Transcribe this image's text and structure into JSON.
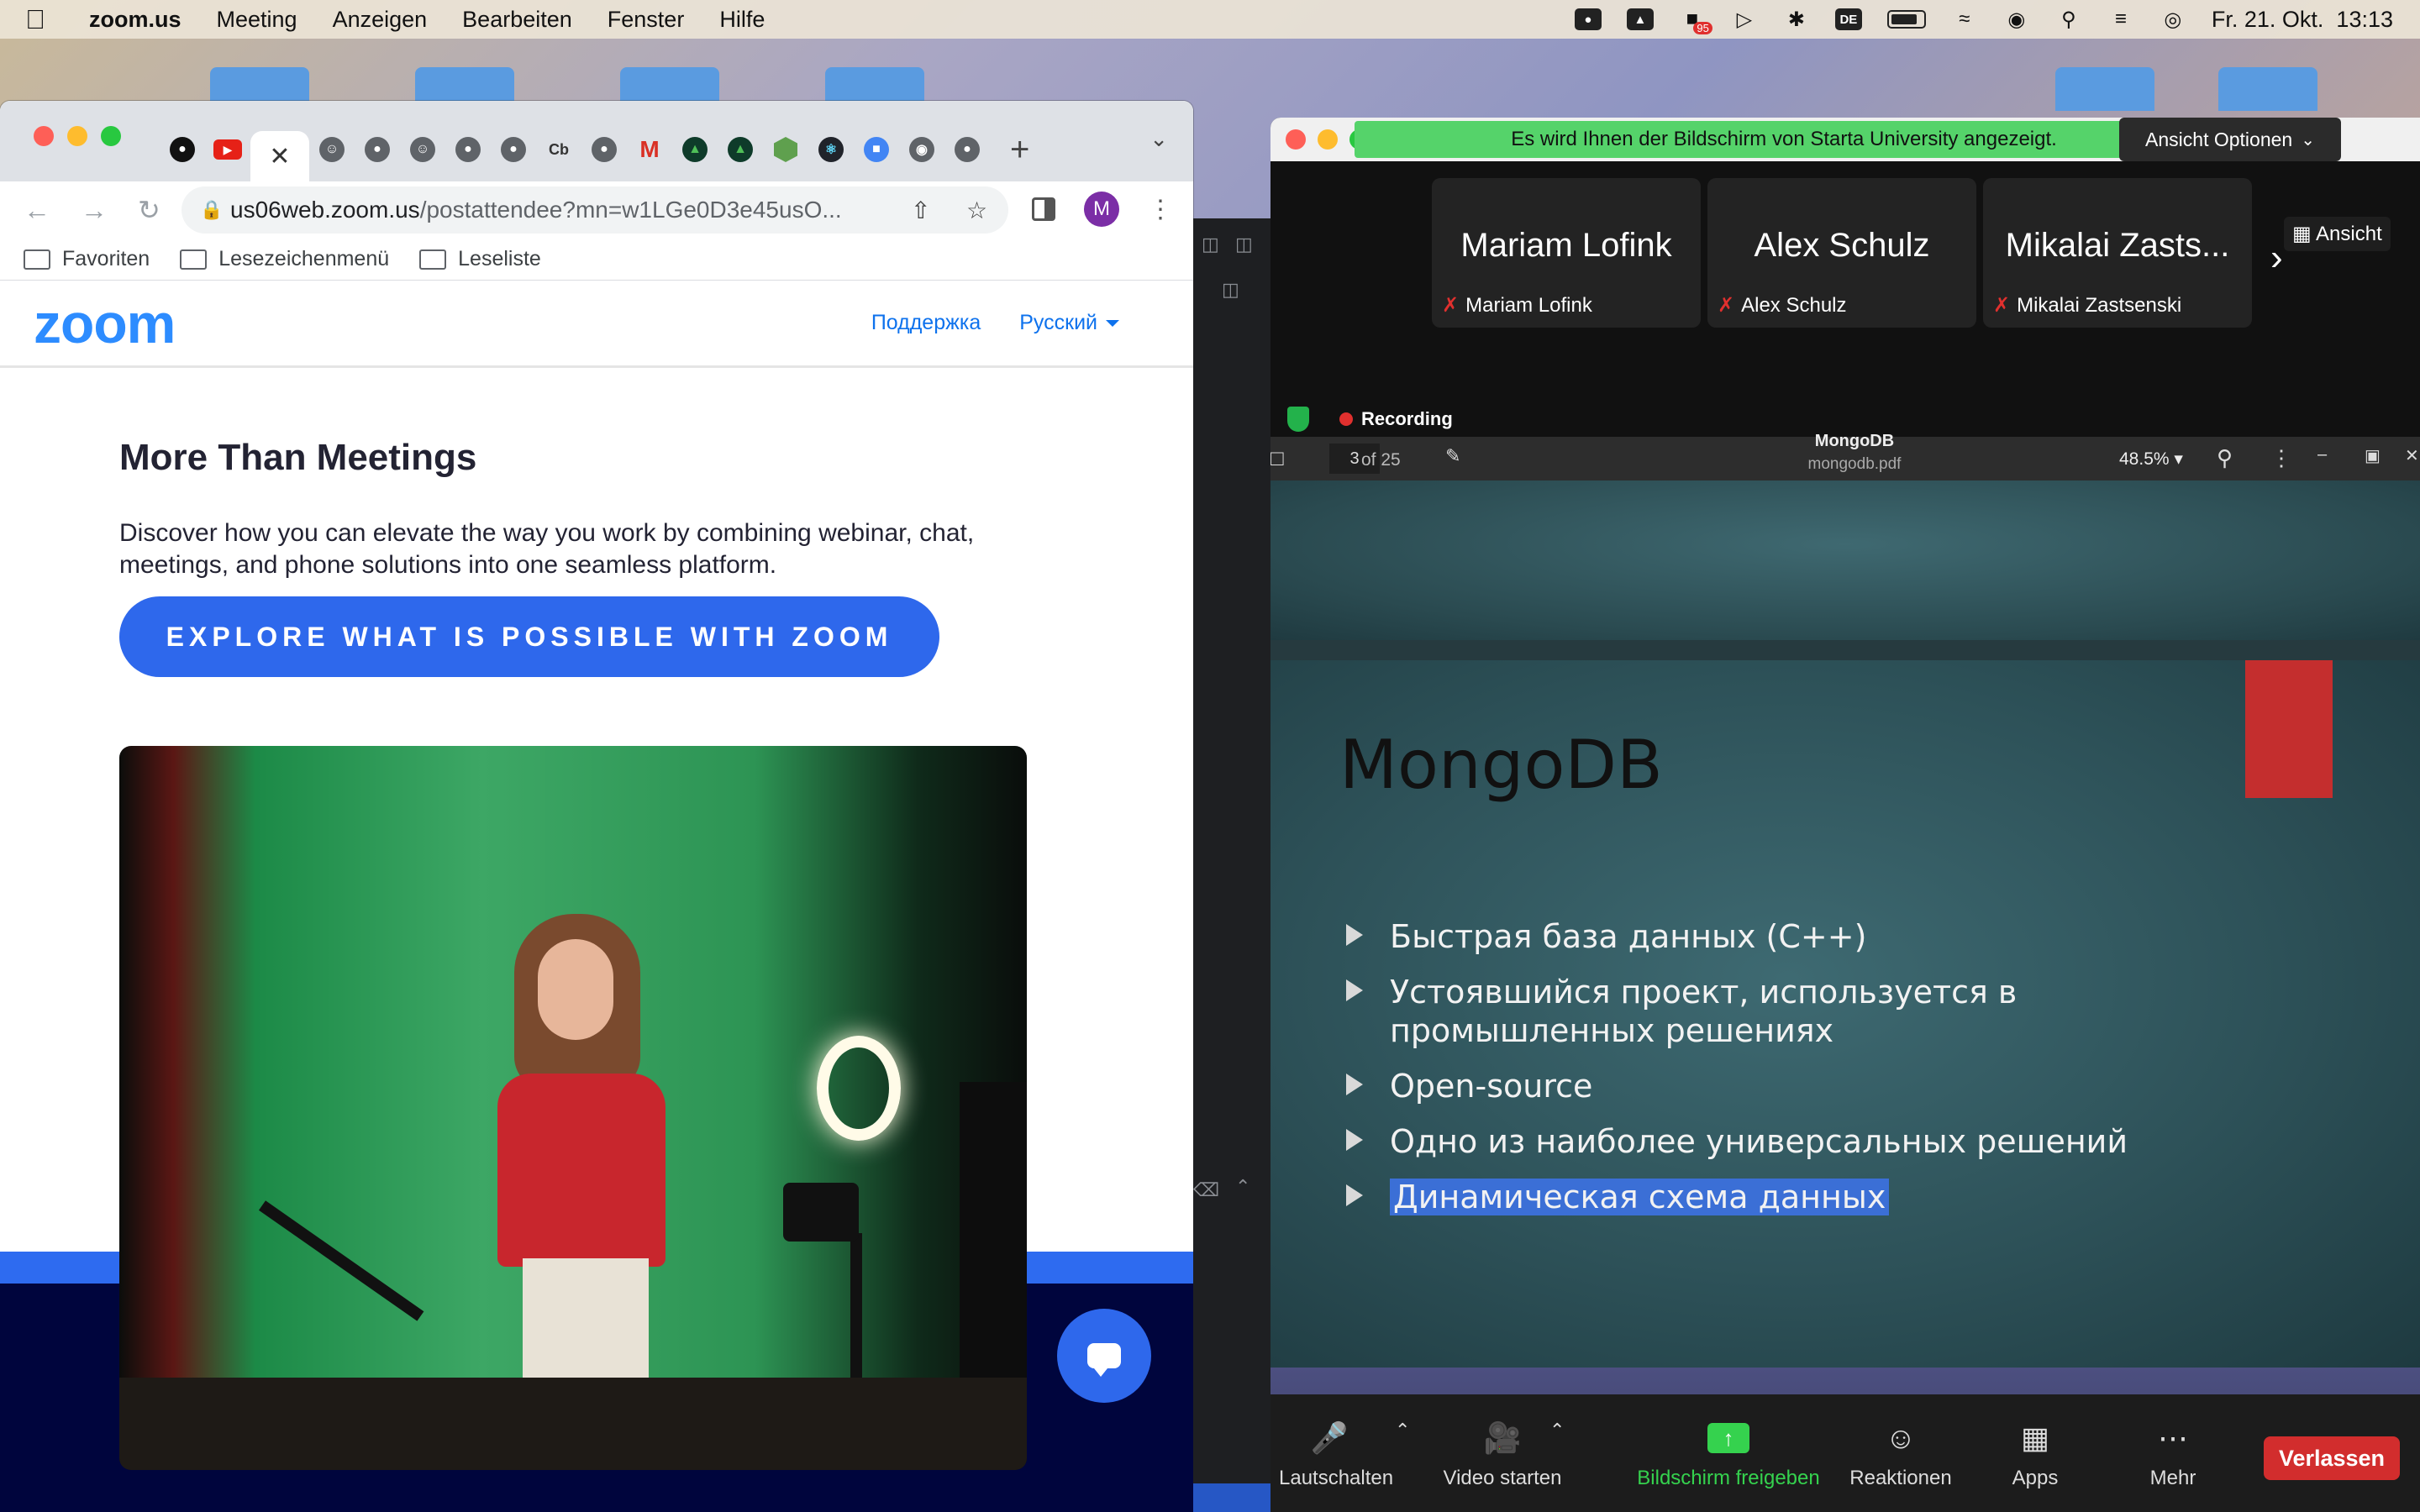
{
  "menubar": {
    "app_name": "zoom.us",
    "menus": [
      "Meeting",
      "Anzeigen",
      "Bearbeiten",
      "Fenster",
      "Hilfe"
    ],
    "badge_count": "95",
    "input_language": "DE",
    "datetime": "Fr. 21. Okt.  13:13"
  },
  "browser": {
    "tab_labels": {
      "coinbase": "Cb"
    },
    "address": {
      "host": "us06web.zoom.us",
      "path": "/postattendee?mn=w1LGe0D3e45usO..."
    },
    "profile_initial": "M",
    "bookmarks": [
      "Favoriten",
      "Lesezeichenmenü",
      "Leseliste"
    ]
  },
  "zoom_page": {
    "logo": "zoom",
    "nav": {
      "support": "Поддержка",
      "language": "Русский"
    },
    "title": "More Than Meetings",
    "description": "Discover how you can elevate the way you work by combining webinar, chat, meetings, and phone solutions into one seamless platform.",
    "cta": "EXPLORE WHAT IS POSSIBLE WITH ZOOM"
  },
  "meeting": {
    "share_banner": "Es wird Ihnen der Bildschirm von Starta University angezeigt.",
    "view_options": "Ansicht Optionen",
    "view_button": "Ansicht",
    "participants": [
      {
        "display": "Mariam Lofink",
        "name": "Mariam Lofink"
      },
      {
        "display": "Alex Schulz",
        "name": "Alex Schulz"
      },
      {
        "display": "Mikalai Zasts...",
        "name": "Mikalai Zastsenski"
      }
    ],
    "recording": "Recording"
  },
  "pdf": {
    "page": "3",
    "of_pages": "of 25",
    "file_title": "MongoDB",
    "file_name": "mongodb.pdf",
    "zoom": "48.5%"
  },
  "slide": {
    "title": "MongoDB",
    "bullets": [
      "Быстрая база данных (C++)",
      "Устоявшийся проект, используется в промышленных решениях",
      "Open-source",
      "Одно из наиболее универсальных решений",
      "Динамическая схема данных"
    ]
  },
  "controls": {
    "mute": "Lautschalten",
    "video": "Video starten",
    "share": "Bildschirm freigeben",
    "reactions": "Reaktionen",
    "apps": "Apps",
    "more": "Mehr",
    "leave": "Verlassen"
  },
  "colors": {
    "zoom_blue": "#2e68ec",
    "share_green": "#55d36a",
    "leave_red": "#d22d2d",
    "recording_red": "#e0302e"
  }
}
